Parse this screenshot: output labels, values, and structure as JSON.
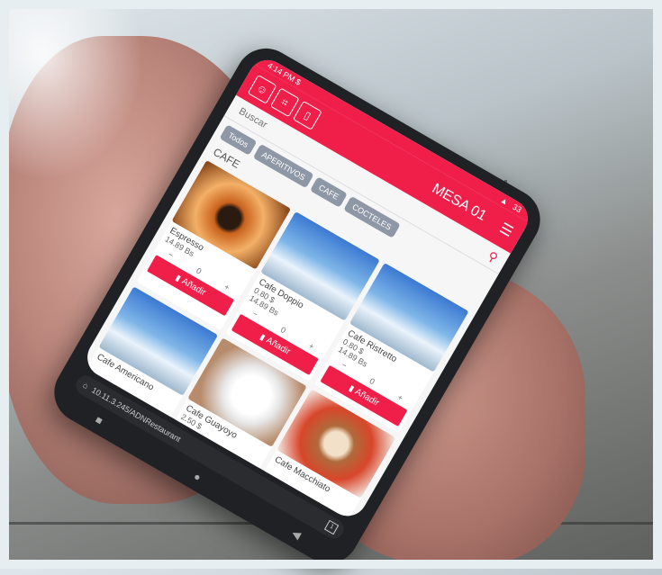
{
  "status_bar": {
    "time": "4:14 PM $",
    "battery": "33"
  },
  "header": {
    "title": "MESA 01",
    "buttons": [
      "person-icon",
      "tables-icon",
      "receipt-icon"
    ],
    "menu_icon": "hamburger-menu-icon"
  },
  "search": {
    "placeholder": "Buscar"
  },
  "categories": [
    "Todos",
    "APERITIVOS",
    "CAFE",
    "COCTELES"
  ],
  "section_title": "CAFE",
  "products": [
    {
      "name": "Espresso",
      "usd": "",
      "bs": "14.89 Bs",
      "qty": "0",
      "add_label": "Añadir"
    },
    {
      "name": "Cafe Doppio",
      "usd": "0.80 $",
      "bs": "14.89 Bs",
      "qty": "0",
      "add_label": "Añadir"
    },
    {
      "name": "Cafe Ristretto",
      "usd": "0.80 $",
      "bs": "14.89 Bs",
      "qty": "0",
      "add_label": "Añadir"
    },
    {
      "name": "Cafe Americano",
      "usd": "",
      "bs": "",
      "qty": "",
      "add_label": ""
    },
    {
      "name": "Cafe Guayoyo",
      "usd": "2.50 $",
      "bs": "",
      "qty": "",
      "add_label": ""
    },
    {
      "name": "Cafe Macchiato",
      "usd": "",
      "bs": "",
      "qty": "",
      "add_label": ""
    }
  ],
  "browser": {
    "url": "10.11.3.245/ADNRestaurant"
  },
  "colors": {
    "accent": "#ef1f4a",
    "chip": "#8e97a6"
  }
}
